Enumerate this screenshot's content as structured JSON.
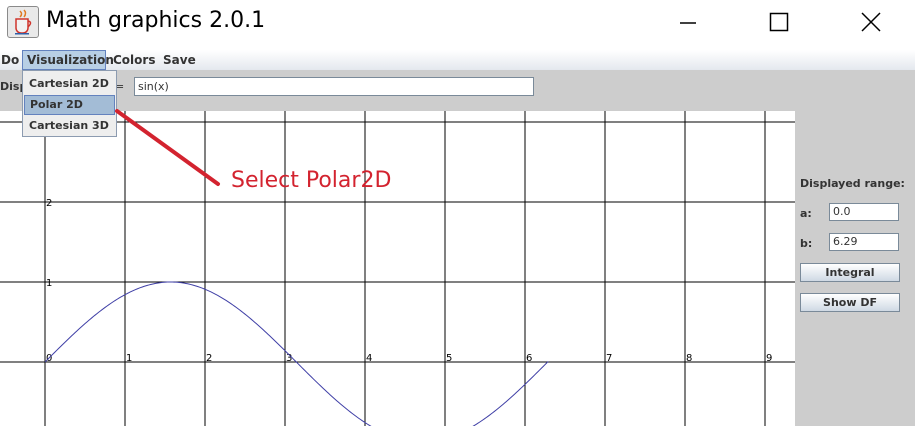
{
  "window": {
    "title": "Math graphics 2.0.1",
    "icon": "java-cup-icon",
    "controls": [
      "minimize-icon",
      "maximize-icon",
      "close-icon"
    ]
  },
  "menubar": {
    "items": [
      {
        "label": "Do"
      },
      {
        "label": "Visualization"
      },
      {
        "label": "Colors"
      },
      {
        "label": "Save"
      }
    ]
  },
  "toolbar": {
    "label": "Disp",
    "equals": "=",
    "function_value": "sin(x)"
  },
  "dropdown": {
    "items": [
      {
        "label": "Cartesian 2D"
      },
      {
        "label": "Polar 2D",
        "selected": true
      },
      {
        "label": "Cartesian 3D"
      }
    ]
  },
  "plot": {
    "x_ticks": [
      "0",
      "1",
      "2",
      "3",
      "4",
      "5",
      "6",
      "7",
      "8",
      "9"
    ],
    "y_ticks": [
      "2",
      "1",
      "0"
    ],
    "function": "sin(x)",
    "x_range": [
      0,
      6.29
    ],
    "curve_color": "#3f3fa6"
  },
  "range_panel": {
    "title": "Displayed range:",
    "a_label": "a:",
    "a_value": "0.0",
    "b_label": "b:",
    "b_value": "6.29",
    "integral_button": "Integral",
    "show_df_button": "Show DF"
  },
  "annotation": {
    "text": "Select Polar2D",
    "color": "#d3232f"
  }
}
